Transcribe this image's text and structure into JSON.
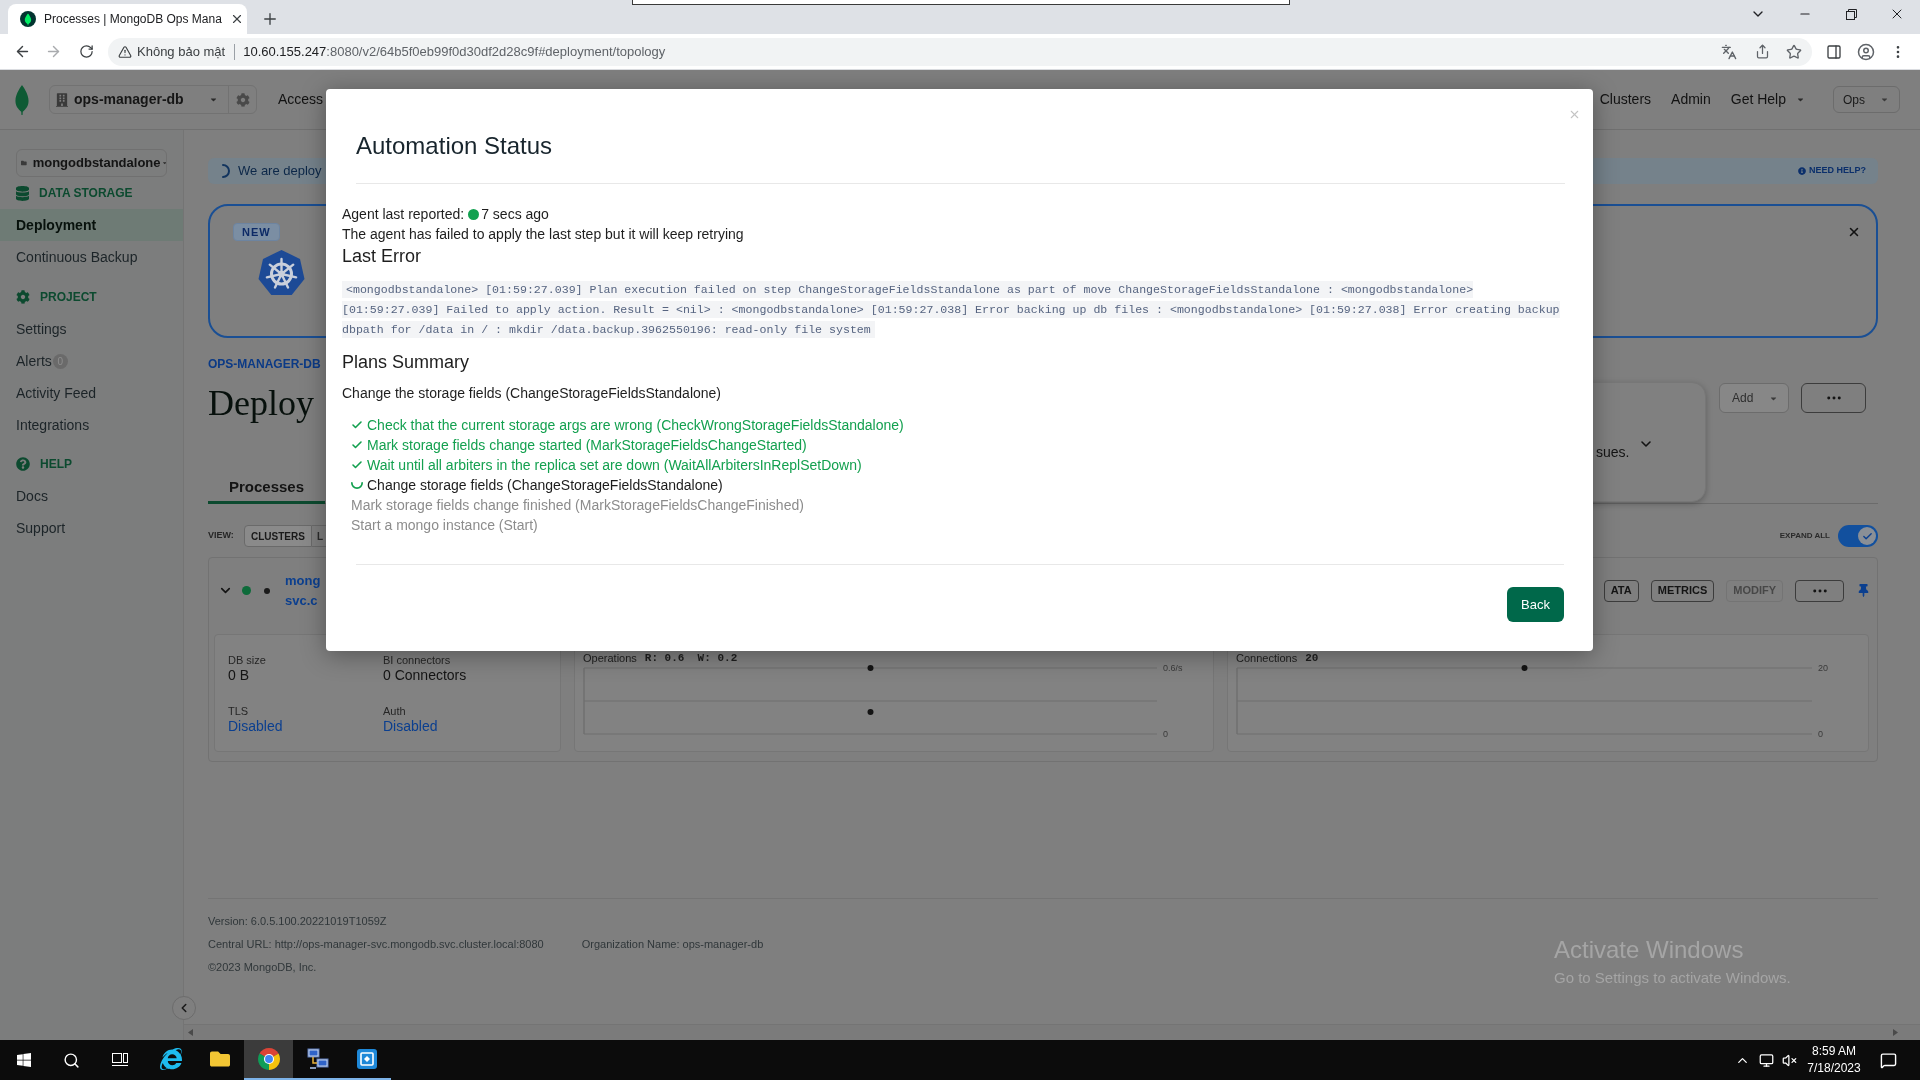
{
  "browser": {
    "tabs": [
      {
        "title": "Processes | MongoDB Ops Mana",
        "selected": true
      }
    ],
    "address_bar": {
      "security_label": "Không bảo mật",
      "url_host": "10.60.155.247",
      "url_path": ":8080/v2/64b5f0eb99f0d30df2d28c9f#deployment/topology"
    }
  },
  "header": {
    "organization": "ops-manager-db",
    "nav_left": [
      "Access"
    ],
    "nav_right": [
      {
        "label": "Clusters",
        "dropdown": false
      },
      {
        "label": "Admin",
        "dropdown": false
      },
      {
        "label": "Get Help",
        "dropdown": true
      }
    ],
    "user_menu": "Ops"
  },
  "sidebar": {
    "project": "mongodbstandalone",
    "sections": [
      {
        "title": "DATA STORAGE",
        "items": [
          {
            "label": "Deployment",
            "selected": true
          },
          {
            "label": "Continuous Backup",
            "selected": false
          }
        ]
      },
      {
        "title": "PROJECT",
        "items": [
          {
            "label": "Settings",
            "selected": false
          },
          {
            "label": "Alerts",
            "badge": "0",
            "selected": false
          },
          {
            "label": "Activity Feed",
            "selected": false
          },
          {
            "label": "Integrations",
            "selected": false
          }
        ]
      },
      {
        "title": "HELP",
        "items": [
          {
            "label": "Docs",
            "selected": false
          },
          {
            "label": "Support",
            "selected": false
          }
        ]
      }
    ]
  },
  "main": {
    "banner": {
      "text": "We are deploy",
      "help_link": "NEED HELP?"
    },
    "promo_card": {
      "badge": "NEW"
    },
    "breadcrumb": "OPS-MANAGER-DB",
    "title": "Deploy",
    "add_button": {
      "label": "Add",
      "disabled": true
    },
    "issues_panel": {
      "text": "sues."
    },
    "tabs": [
      {
        "label": "Processes",
        "selected": true
      }
    ],
    "view": {
      "label": "VIEW:",
      "options": [
        {
          "label": "CLUSTERS",
          "selected": true
        },
        {
          "label": "L",
          "selected": false
        }
      ]
    },
    "expand_all": {
      "label": "EXPAND ALL",
      "on": true
    },
    "cluster": {
      "expanded": true,
      "name_lines": [
        "mong",
        "svc.c"
      ],
      "actions": [
        {
          "label": "ATA",
          "disabled": false
        },
        {
          "label": "METRICS",
          "disabled": false
        },
        {
          "label": "MODIFY",
          "disabled": true
        }
      ],
      "stats": [
        {
          "label": "DB size",
          "value": "0 B",
          "kind": "text"
        },
        {
          "label": "BI connectors",
          "value": "0 Connectors",
          "kind": "text"
        },
        {
          "label": "TLS",
          "value": "Disabled",
          "kind": "link"
        },
        {
          "label": "Auth",
          "value": "Disabled",
          "kind": "link"
        }
      ],
      "charts": [
        {
          "reading": "R: 0.6  W: 0.2",
          "chart_data": {
            "type": "scatter",
            "title": "Operations",
            "categories": [
              null
            ],
            "series": [
              {
                "color": "#141414",
                "values": [
                  0.6
                ]
              },
              {
                "color": "#141414",
                "values": [
                  0.2
                ]
              }
            ],
            "ylim": [
              0,
              0.6
            ],
            "yticks": [
              {
                "value": 0,
                "label": "0"
              },
              {
                "value": 0.6,
                "label": "0.6/s"
              }
            ],
            "ref_lines": [
              {
                "axis": "y",
                "value": 0.3
              }
            ]
          }
        },
        {
          "reading": "20",
          "chart_data": {
            "type": "scatter",
            "title": "Connections",
            "categories": [
              null
            ],
            "series": [
              {
                "color": "#141414",
                "values": [
                  20
                ]
              }
            ],
            "ylim": [
              0,
              20
            ],
            "yticks": [
              {
                "value": 0,
                "label": "0"
              },
              {
                "value": 20,
                "label": "20"
              }
            ],
            "ref_lines": [
              {
                "axis": "y",
                "value": 10
              }
            ]
          }
        }
      ]
    }
  },
  "footer": {
    "version": "Version: 6.0.5.100.20221019T1059Z",
    "central_url": "Central URL: http://ops-manager-svc.mongodb.svc.cluster.local:8080",
    "organization": "Organization Name: ops-manager-db",
    "copyright": "©2023 MongoDB, Inc."
  },
  "modal": {
    "title": "Automation Status",
    "agent_label": "Agent last reported:",
    "agent_time": "7 secs ago",
    "message": "The agent has failed to apply the last step but it will keep retrying",
    "last_error_heading": "Last Error",
    "last_error": "<mongodbstandalone> [01:59:27.039] Plan execution failed on step ChangeStorageFieldsStandalone as part of move ChangeStorageFieldsStandalone : <mongodbstandalone> [01:59:27.039] Failed to apply action. Result = <nil> : <mongodbstandalone> [01:59:27.038] Error backing up db files : <mongodbstandalone> [01:59:27.038] Error creating backup dbpath for /data in / : mkdir /data.backup.3962550196: read-only file system",
    "plans_heading": "Plans Summary",
    "plan_title": "Change the storage fields (ChangeStorageFieldsStandalone)",
    "steps": [
      {
        "label": "Check that the current storage args are wrong (CheckWrongStorageFieldsStandalone)",
        "done": true,
        "active": false
      },
      {
        "label": "Mark storage fields change started (MarkStorageFieldsChangeStarted)",
        "done": true,
        "active": false
      },
      {
        "label": "Wait until all arbiters in the replica set are down (WaitAllArbitersInReplSetDown)",
        "done": true,
        "active": false
      },
      {
        "label": "Change storage fields (ChangeStorageFieldsStandalone)",
        "done": false,
        "active": true
      },
      {
        "label": "Mark storage fields change finished (MarkStorageFieldsChangeFinished)",
        "done": false,
        "active": false
      },
      {
        "label": "Start a mongo instance (Start)",
        "done": false,
        "active": false
      }
    ],
    "back_button": "Back"
  },
  "activation_notice": {
    "title": "Activate Windows",
    "subtitle": "Go to Settings to activate Windows."
  },
  "taskbar": {
    "apps": [
      {
        "running": false,
        "selected": false
      },
      {
        "running": false,
        "selected": false
      },
      {
        "running": true,
        "selected": true
      },
      {
        "running": true,
        "selected": false
      },
      {
        "running": true,
        "selected": false
      }
    ],
    "clock": {
      "time": "8:59 AM",
      "date": "7/18/2023"
    }
  }
}
